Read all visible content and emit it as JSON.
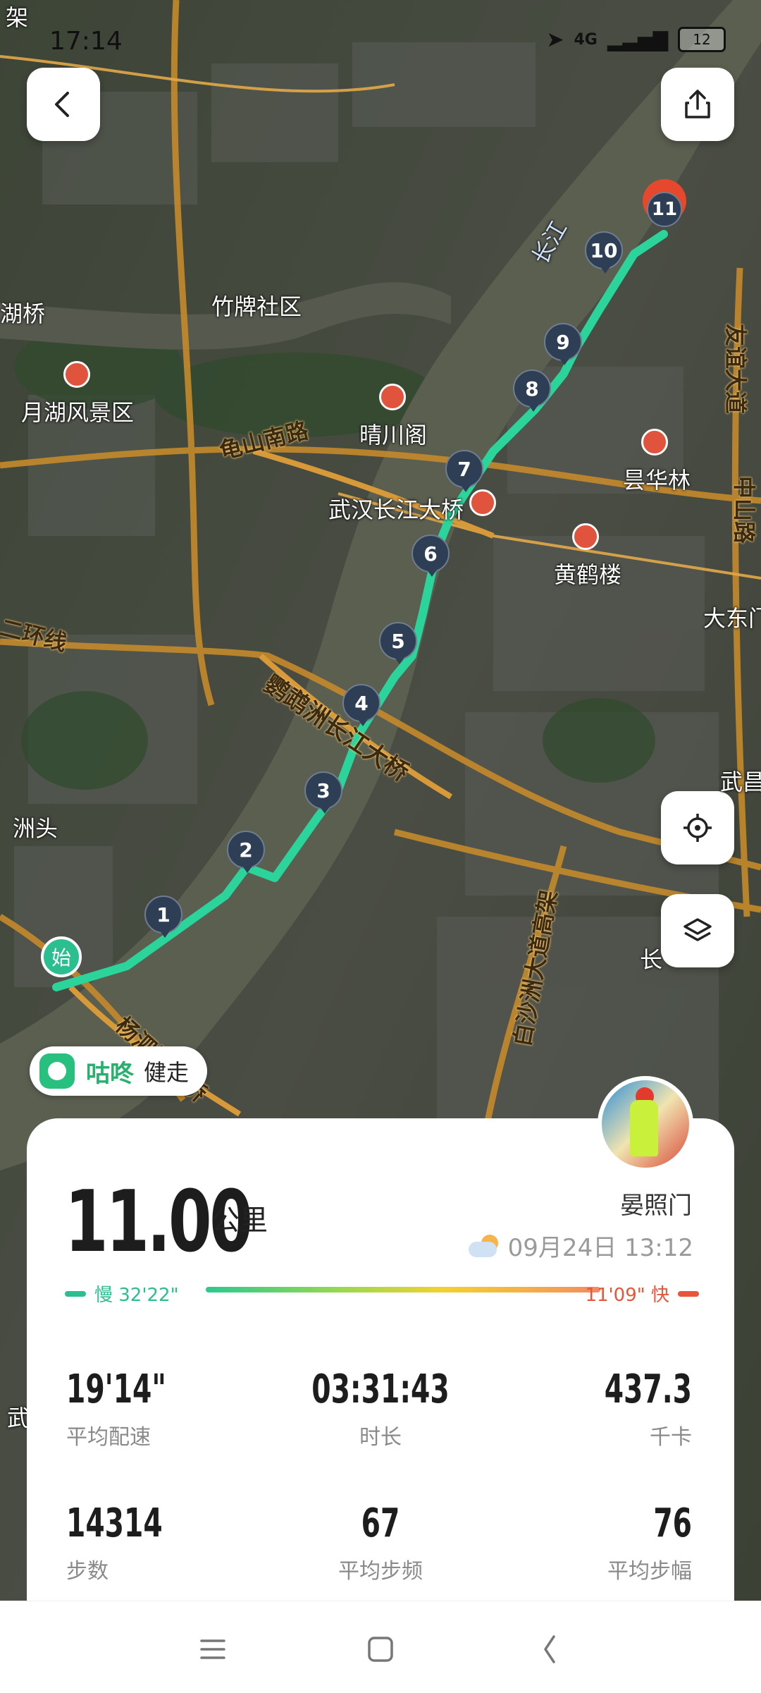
{
  "status_bar": {
    "time": "17:14",
    "network": "4G",
    "battery": "12"
  },
  "map": {
    "labels": {
      "river": "长江",
      "zhupai": "竹牌社区",
      "yuehu": "月湖风景区",
      "guishan": "龟山南路",
      "qingchuan": "晴川阁",
      "changjiang_bridge": "武汉长江大桥",
      "yellow_crane": "黄鹤楼",
      "minghua": "昙华林",
      "yingwuzhou": "鹦鹉洲长江大桥",
      "erhuan": "二环线",
      "zhoutou": "洲头",
      "baishazhou": "白沙洲大道高架",
      "yangsi": "杨泗港大桥",
      "dadong": "大东门",
      "wuchang": "武昌",
      "youyi": "友谊大道",
      "zhongshan": "中山路",
      "huqiao": "湖桥",
      "chang": "长",
      "jia": "架",
      "wu": "武"
    },
    "km_markers": [
      "1",
      "2",
      "3",
      "4",
      "5",
      "6",
      "7",
      "8",
      "9",
      "10"
    ],
    "end_marker": "11",
    "start_marker": "始"
  },
  "badge": {
    "brand": "咕咚",
    "mode": "健走"
  },
  "summary": {
    "distance": "11.00",
    "unit": "公里",
    "place": "晏照门",
    "datetime": "09月24日 13:12",
    "pace_slow": "慢 32'22\"",
    "pace_fast": "11'09\" 快"
  },
  "stats": [
    {
      "value": "19'14\"",
      "label": "平均配速"
    },
    {
      "value": "03:31:43",
      "label": "时长"
    },
    {
      "value": "437.3",
      "label": "千卡"
    },
    {
      "value": "14314",
      "label": "步数"
    },
    {
      "value": "67",
      "label": "平均步频"
    },
    {
      "value": "76",
      "label": "平均步幅"
    }
  ],
  "colors": {
    "route": "#2bd49a",
    "accent": "#27b06e",
    "marker": "#2e3f55",
    "end": "#e5482c"
  }
}
